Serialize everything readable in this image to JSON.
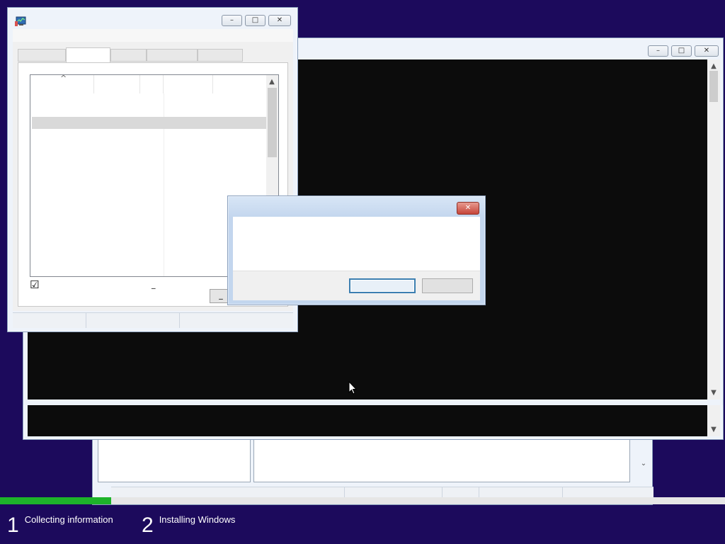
{
  "setup_steps": [
    {
      "number": "1",
      "label": "Collecting information"
    },
    {
      "number": "2",
      "label": "Installing Windows"
    }
  ],
  "progress": {
    "value": 0.153,
    "color": "#1db32a"
  },
  "console_window": {
    "buttons": {
      "minimize": "–",
      "maximize": "□",
      "close": "✕"
    },
    "scroll_up": "▲",
    "scroll_down": "▼"
  },
  "task_manager_window": {
    "icon": "task-manager-icon",
    "buttons": {
      "minimize": "–",
      "maximize": "□",
      "close": "✕"
    },
    "sort_arrow": "^",
    "checkbox_checked": true,
    "checkbox_glyph": "☑",
    "small_glyph": "_",
    "partial_button_glyph": "_",
    "scroll_up": "▲",
    "scroll_down": "▼"
  },
  "dialog": {
    "close_glyph": "✕"
  },
  "behind_window": {
    "scroll_down": "⌄"
  },
  "colors": {
    "desktop": "#1c0a5c",
    "console_bg": "#0c0c0c",
    "progress": "#1db32a"
  }
}
